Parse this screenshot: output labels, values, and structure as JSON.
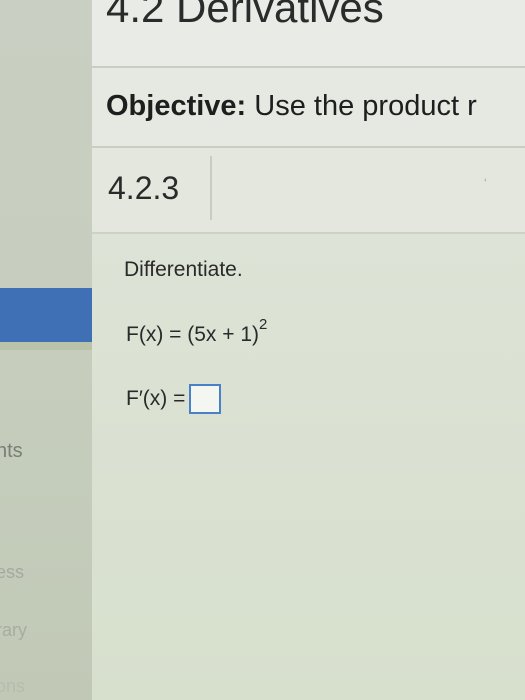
{
  "sidebar": {
    "items": [
      {
        "label": "nts"
      },
      {
        "label": "ess"
      },
      {
        "label": "rary"
      },
      {
        "label": "ons"
      }
    ]
  },
  "header": {
    "section_title": "4.2 Derivatives"
  },
  "objective": {
    "label": "Objective:",
    "text": "Use the product r"
  },
  "problem": {
    "number": "4.2.3",
    "instruction": "Differentiate.",
    "function_lhs": "F(x) = (5x + 1)",
    "function_exponent": "2",
    "answer_label": "F′(x) ="
  },
  "colors": {
    "sidebar_highlight": "#3f6fb4",
    "answer_box_border": "#4a80c8"
  }
}
